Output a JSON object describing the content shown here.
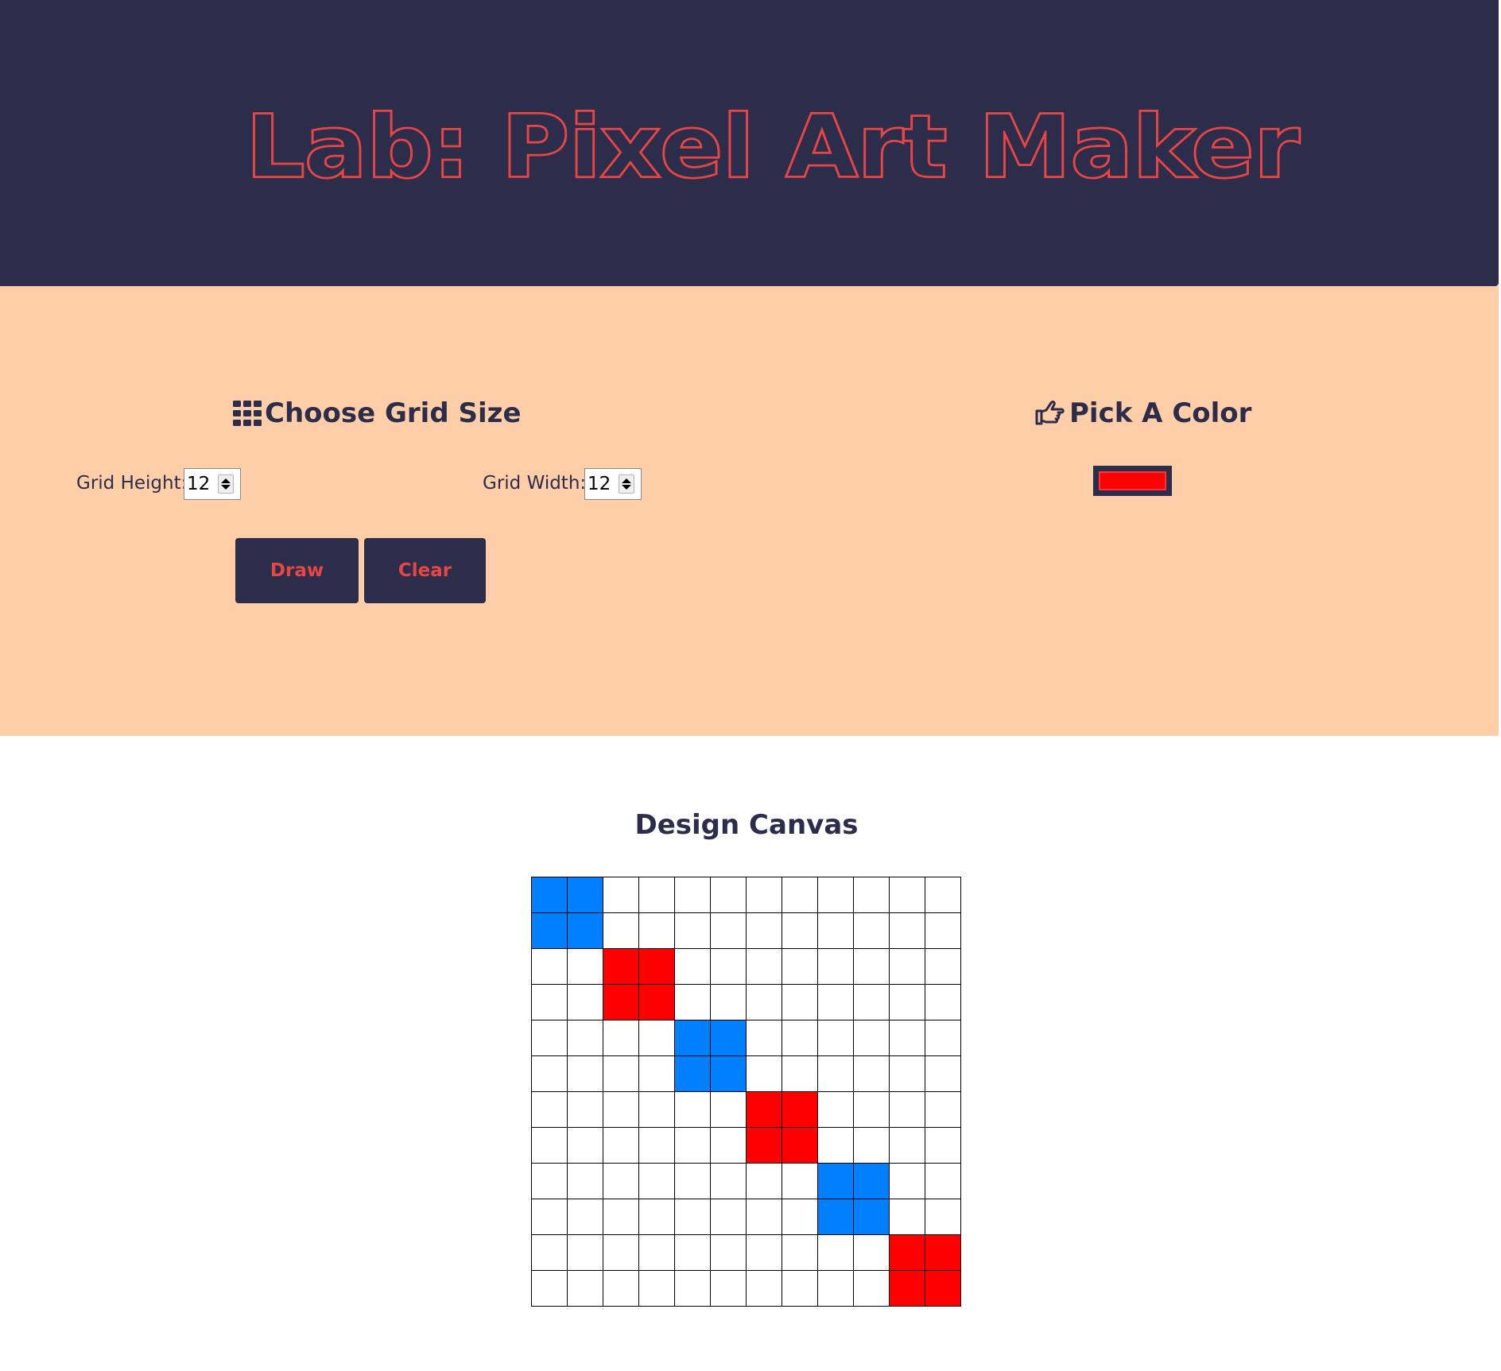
{
  "header": {
    "title": "Lab: Pixel Art Maker"
  },
  "colors": {
    "navy": "#2b2d4a",
    "accent_red": "#e84545",
    "peach": "#fecea8",
    "paint_red": "#ff0000",
    "paint_blue": "#0080ff"
  },
  "grid_size": {
    "title": "Choose Grid Size",
    "icon": "grid-icon",
    "height_label": "Grid Height:",
    "height_value": "12",
    "width_label": "Grid Width:",
    "width_value": "12",
    "draw_label": "Draw",
    "clear_label": "Clear"
  },
  "color_picker": {
    "title": "Pick A Color",
    "icon": "hand-pointing-icon",
    "value": "#ff0000"
  },
  "canvas": {
    "title": "Design Canvas",
    "rows": 12,
    "cols": 12,
    "cells": [
      [
        "B",
        "B",
        "",
        "",
        "",
        "",
        "",
        "",
        "",
        "",
        "",
        ""
      ],
      [
        "B",
        "B",
        "",
        "",
        "",
        "",
        "",
        "",
        "",
        "",
        "",
        ""
      ],
      [
        "",
        "",
        "R",
        "R",
        "",
        "",
        "",
        "",
        "",
        "",
        "",
        ""
      ],
      [
        "",
        "",
        "R",
        "R",
        "",
        "",
        "",
        "",
        "",
        "",
        "",
        ""
      ],
      [
        "",
        "",
        "",
        "",
        "B",
        "B",
        "",
        "",
        "",
        "",
        "",
        ""
      ],
      [
        "",
        "",
        "",
        "",
        "B",
        "B",
        "",
        "",
        "",
        "",
        "",
        ""
      ],
      [
        "",
        "",
        "",
        "",
        "",
        "",
        "R",
        "R",
        "",
        "",
        "",
        ""
      ],
      [
        "",
        "",
        "",
        "",
        "",
        "",
        "R",
        "R",
        "",
        "",
        "",
        ""
      ],
      [
        "",
        "",
        "",
        "",
        "",
        "",
        "",
        "",
        "B",
        "B",
        "",
        ""
      ],
      [
        "",
        "",
        "",
        "",
        "",
        "",
        "",
        "",
        "B",
        "B",
        "",
        ""
      ],
      [
        "",
        "",
        "",
        "",
        "",
        "",
        "",
        "",
        "",
        "",
        "R",
        "R"
      ],
      [
        "",
        "",
        "",
        "",
        "",
        "",
        "",
        "",
        "",
        "",
        "R",
        "R"
      ]
    ]
  }
}
